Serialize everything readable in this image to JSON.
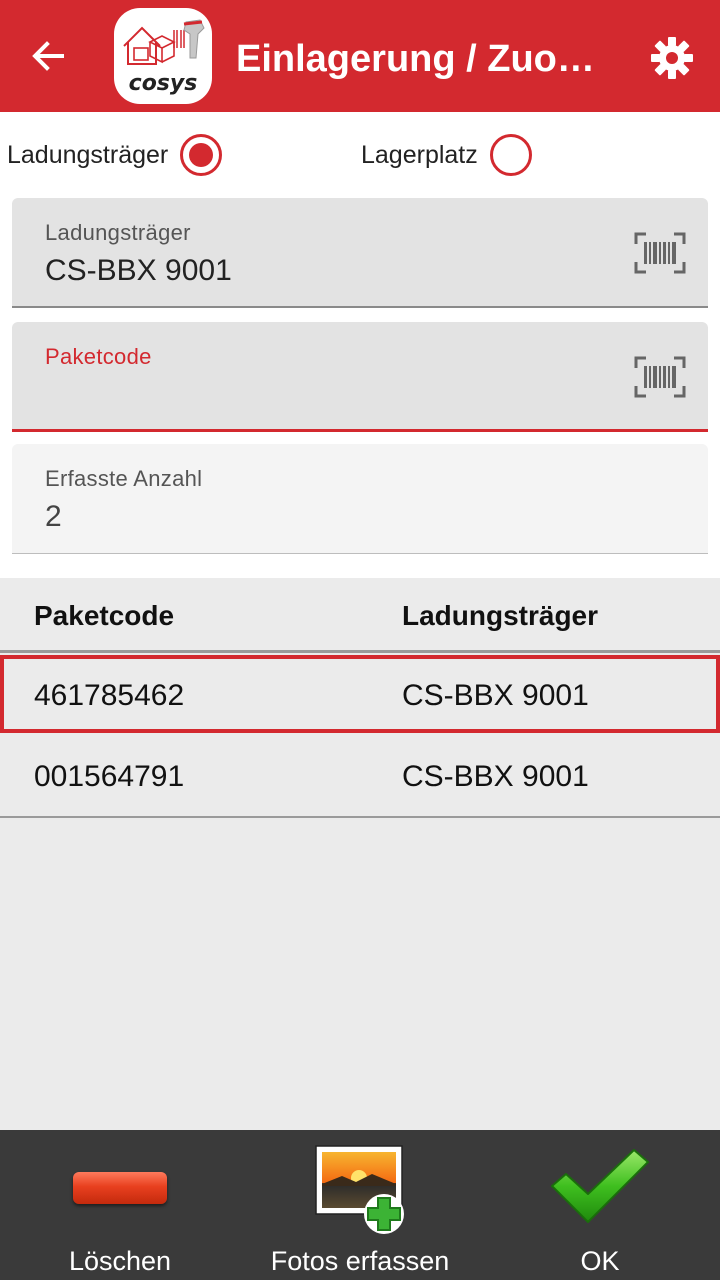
{
  "appbar": {
    "title": "Einlagerung / Zuor…",
    "accent_color": "#d3292f",
    "back_icon": "arrow-left-icon",
    "settings_icon": "gear-icon",
    "logo_text": "cosys"
  },
  "mode": {
    "option1_label": "Ladungsträger",
    "option1_selected": true,
    "option2_label": "Lagerplatz",
    "option2_selected": false
  },
  "fields": {
    "carrier": {
      "label": "Ladungsträger",
      "value": "CS-BBX 9001"
    },
    "package": {
      "label": "Paketcode",
      "value": ""
    },
    "count": {
      "label": "Erfasste Anzahl",
      "value": "2"
    }
  },
  "table": {
    "headers": [
      "Paketcode",
      "Ladungsträger"
    ],
    "rows": [
      [
        "461785462",
        "CS-BBX 9001"
      ],
      [
        "001564791",
        "CS-BBX 9001"
      ]
    ]
  },
  "bottombar": {
    "delete_label": "Löschen",
    "photos_label": "Fotos erfassen",
    "ok_label": "OK"
  }
}
